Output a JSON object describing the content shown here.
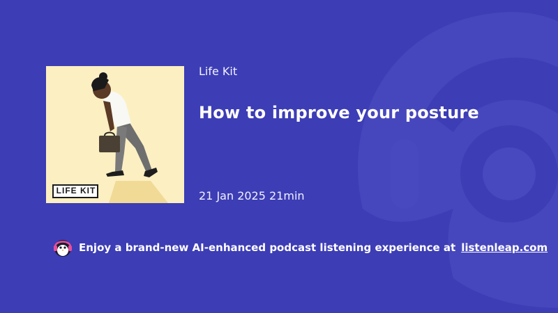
{
  "podcast": {
    "show_name": "Life Kit",
    "episode_title": "How to improve your posture",
    "date": "21 Jan 2025",
    "duration": "21min",
    "cover_logo_text": "LIFE KIT"
  },
  "promo": {
    "text": "Enjoy a brand-new AI-enhanced podcast listening experience at",
    "link_text": "listenleap.com"
  },
  "colors": {
    "background": "#3d3db5",
    "cover_background": "#fcefc2",
    "watermark": "#4a4abf"
  },
  "icons": {
    "mascot": "penguin-headphones-icon",
    "watermark": "headphones-logo-watermark"
  }
}
